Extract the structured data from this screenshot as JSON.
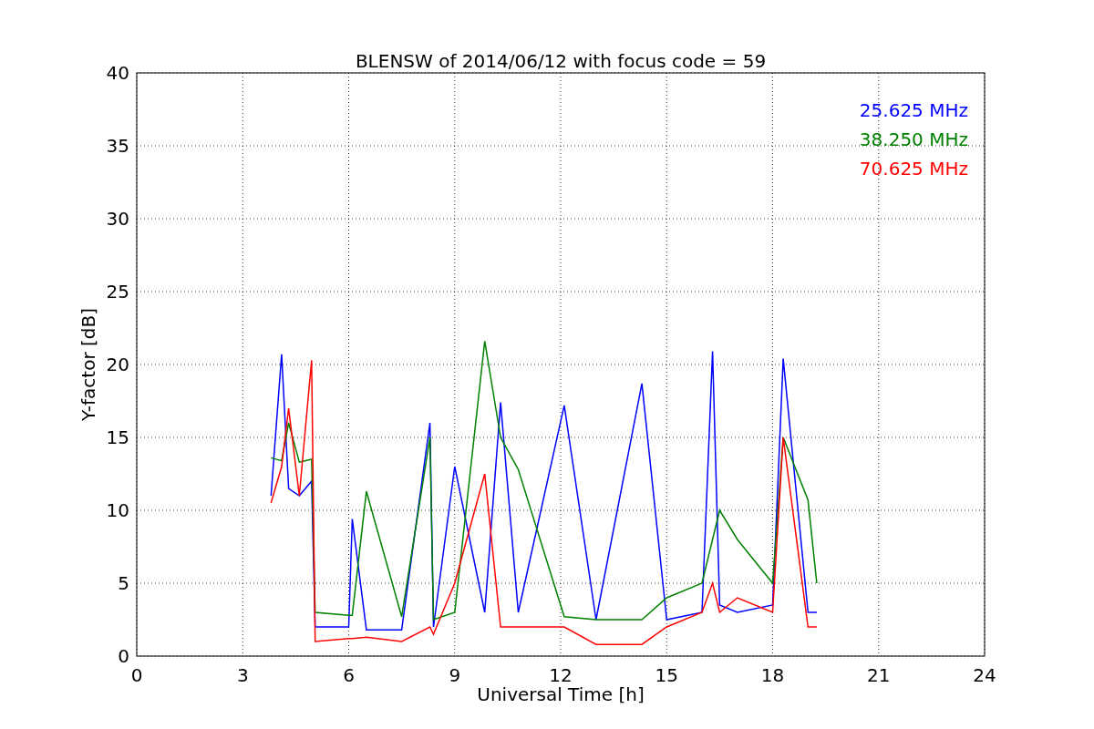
{
  "chart_data": {
    "type": "line",
    "title": "BLENSW of 2014/06/12 with focus code = 59",
    "xlabel": "Universal Time [h]",
    "ylabel": "Y-factor [dB]",
    "x": [
      3.8,
      4.1,
      4.3,
      4.6,
      4.95,
      5.05,
      6.0,
      6.1,
      6.5,
      7.5,
      8.3,
      8.4,
      9.0,
      9.85,
      10.3,
      10.8,
      12.1,
      13.0,
      14.3,
      15.0,
      16.0,
      16.3,
      16.5,
      17.0,
      18.0,
      18.3,
      19.0,
      19.25
    ],
    "series": [
      {
        "name": "25.625 MHz",
        "color": "#0000ff",
        "values": [
          11,
          20.7,
          11.5,
          11,
          12,
          2,
          2,
          9.4,
          1.8,
          1.8,
          16,
          2,
          13,
          3,
          17.4,
          3,
          17.2,
          2.5,
          18.7,
          2.5,
          3,
          20.9,
          3.5,
          3,
          3.5,
          20.4,
          3,
          3
        ]
      },
      {
        "name": "38.250 MHz",
        "color": "#008000",
        "values": [
          13.6,
          13.4,
          16,
          13.3,
          13.5,
          3,
          2.8,
          2.8,
          11.3,
          2.7,
          15,
          2.5,
          3,
          21.6,
          15,
          12.8,
          2.7,
          2.5,
          2.5,
          4,
          5,
          8,
          10,
          8,
          5,
          15,
          10.7,
          5
        ]
      },
      {
        "name": "70.625 MHz",
        "color": "#ff0000",
        "values": [
          10.5,
          13,
          17,
          11,
          20.3,
          1,
          1.2,
          1.2,
          1.3,
          1,
          2,
          1.5,
          5,
          12.5,
          2,
          2,
          2,
          0.8,
          0.8,
          2,
          3,
          5,
          3,
          4,
          3,
          15,
          2,
          2
        ]
      }
    ],
    "xlim": [
      0,
      24
    ],
    "grid": true,
    "ylim": [
      0,
      40
    ],
    "xticks": [
      0,
      3,
      6,
      9,
      12,
      15,
      18,
      21,
      24
    ],
    "yticks": [
      0,
      5,
      10,
      15,
      20,
      25,
      30,
      35,
      40
    ]
  }
}
